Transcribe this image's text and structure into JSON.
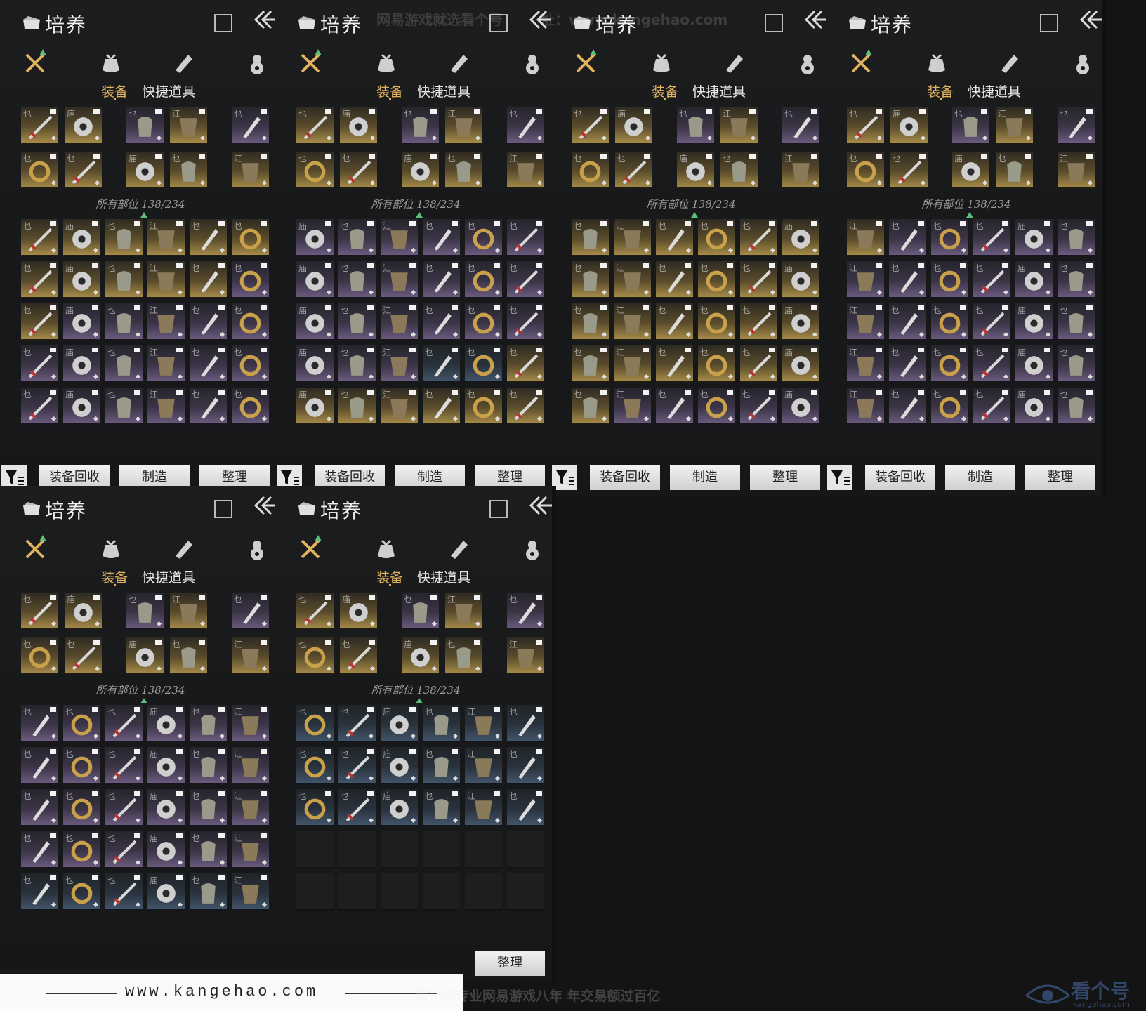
{
  "panel": {
    "title": "培养",
    "categories": [
      {
        "name": "weapon",
        "icon": "crossed-swords-icon"
      },
      {
        "name": "bag",
        "icon": "pouch-icon"
      },
      {
        "name": "scroll",
        "icon": "scroll-icon"
      },
      {
        "name": "gourd",
        "icon": "gourd-icon"
      }
    ],
    "subtabs": {
      "equipment": "装备",
      "quick_items": "快捷道具"
    },
    "count_label": "所有部位 138/234",
    "buttons": {
      "recycle": "装备回收",
      "craft": "制造",
      "sort": "整理"
    }
  },
  "panels": [
    {
      "id": "p1",
      "inventory": [
        [
          "gold",
          "gold",
          "gold",
          "gold",
          "gold",
          "gold"
        ],
        [
          "gold",
          "gold",
          "gold",
          "gold",
          "gold",
          "purple"
        ],
        [
          "gold",
          "purple",
          "purple",
          "purple",
          "purple",
          "purple"
        ],
        [
          "purple",
          "purple",
          "purple",
          "purple",
          "purple",
          "purple"
        ],
        [
          "purple",
          "purple",
          "purple",
          "purple",
          "purple",
          "purple"
        ]
      ]
    },
    {
      "id": "p2",
      "inventory": [
        [
          "purple",
          "purple",
          "purple",
          "purple",
          "purple",
          "purple"
        ],
        [
          "purple",
          "purple",
          "purple",
          "purple",
          "purple",
          "purple"
        ],
        [
          "purple",
          "purple",
          "purple",
          "purple",
          "purple",
          "purple"
        ],
        [
          "purple",
          "purple",
          "purple",
          "blue",
          "blue",
          "gold"
        ],
        [
          "gold",
          "gold",
          "gold",
          "gold",
          "gold",
          "gold"
        ]
      ]
    },
    {
      "id": "p3",
      "inventory": [
        [
          "gold",
          "gold",
          "gold",
          "gold",
          "gold",
          "gold"
        ],
        [
          "gold",
          "gold",
          "gold",
          "gold",
          "gold",
          "gold"
        ],
        [
          "gold",
          "gold",
          "gold",
          "gold",
          "gold",
          "gold"
        ],
        [
          "gold",
          "gold",
          "gold",
          "gold",
          "gold",
          "gold"
        ],
        [
          "gold",
          "purple",
          "purple",
          "purple",
          "purple",
          "purple"
        ]
      ]
    },
    {
      "id": "p4",
      "inventory": [
        [
          "gold",
          "purple",
          "purple",
          "purple",
          "purple",
          "purple"
        ],
        [
          "purple",
          "purple",
          "purple",
          "purple",
          "purple",
          "purple"
        ],
        [
          "purple",
          "purple",
          "purple",
          "purple",
          "purple",
          "purple"
        ],
        [
          "purple",
          "purple",
          "purple",
          "purple",
          "purple",
          "purple"
        ],
        [
          "purple",
          "purple",
          "purple",
          "purple",
          "purple",
          "purple"
        ]
      ]
    },
    {
      "id": "p5",
      "inventory": [
        [
          "purple",
          "purple",
          "purple",
          "purple",
          "purple",
          "purple"
        ],
        [
          "purple",
          "purple",
          "purple",
          "purple",
          "purple",
          "purple"
        ],
        [
          "purple",
          "purple",
          "purple",
          "purple",
          "purple",
          "purple"
        ],
        [
          "purple",
          "purple",
          "purple",
          "purple",
          "purple",
          "purple"
        ],
        [
          "blue",
          "blue",
          "blue",
          "blue",
          "blue",
          "blue"
        ]
      ]
    },
    {
      "id": "p6",
      "inventory": [
        [
          "blue",
          "blue",
          "blue",
          "blue",
          "blue",
          "blue"
        ],
        [
          "blue",
          "blue",
          "blue",
          "blue",
          "blue",
          "blue"
        ],
        [
          "blue",
          "blue",
          "blue",
          "blue",
          "blue",
          "blue"
        ],
        [
          "empty",
          "empty",
          "empty",
          "empty",
          "empty",
          "empty"
        ],
        [
          "empty",
          "empty",
          "empty",
          "empty",
          "empty",
          "empty"
        ]
      ]
    }
  ],
  "equipped": [
    [
      "gold",
      "gold",
      "purple",
      "gold",
      "purple"
    ],
    [
      "gold",
      "gold",
      "gold",
      "gold",
      "gold"
    ]
  ],
  "watermark": {
    "top_text": "网易游戏就选看个号",
    "top_url": "址：www.kangehao.com",
    "footer_url": "www.kangehao.com",
    "footer_slogan": "看个号专业网易游戏八年   年交易额过百亿",
    "logo_text": "看个号",
    "logo_sub": "kangehao.com"
  },
  "colors": {
    "accent_gold": "#e2b35f",
    "up_arrow": "#5cc07a"
  }
}
